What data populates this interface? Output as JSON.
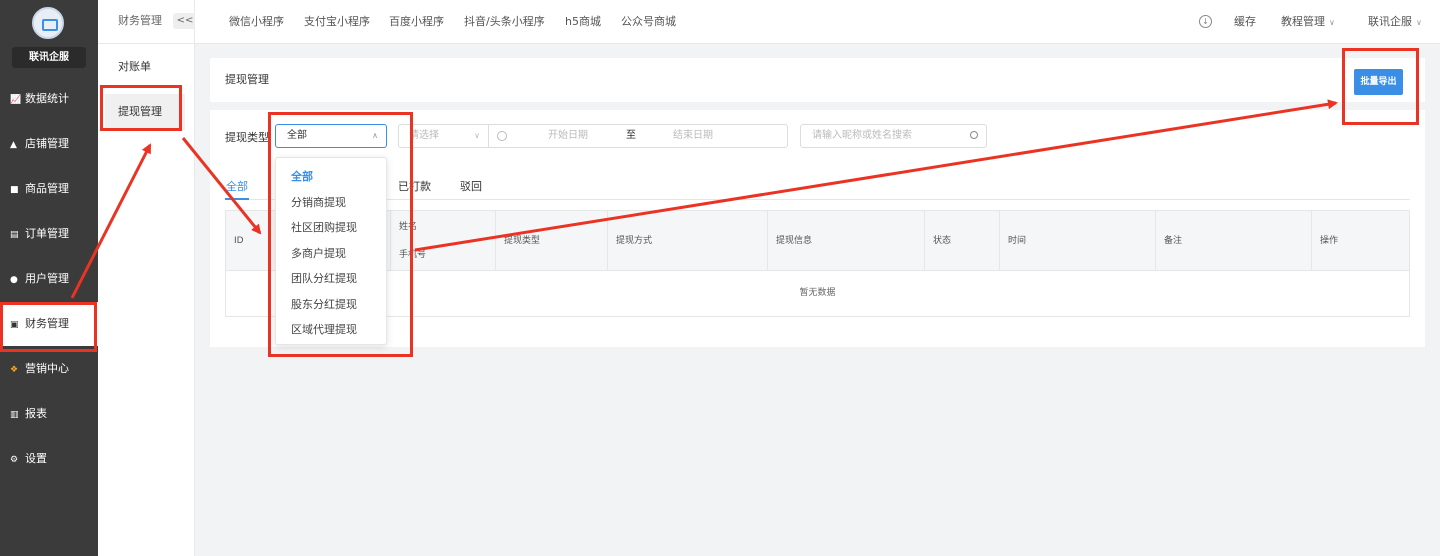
{
  "brand": {
    "name": "联讯企服"
  },
  "sidebar": {
    "items": [
      {
        "label": "数据统计",
        "icon": "chart-line-icon"
      },
      {
        "label": "店铺管理",
        "icon": "store-icon"
      },
      {
        "label": "商品管理",
        "icon": "goods-icon"
      },
      {
        "label": "订单管理",
        "icon": "order-icon"
      },
      {
        "label": "用户管理",
        "icon": "user-icon"
      },
      {
        "label": "财务管理",
        "icon": "finance-icon"
      },
      {
        "label": "营销中心",
        "icon": "marketing-icon"
      },
      {
        "label": "报表",
        "icon": "bar-chart-icon"
      },
      {
        "label": "设置",
        "icon": "gear-icon"
      }
    ]
  },
  "subnav": {
    "title": "财务管理",
    "collapse_label": "<<",
    "items": [
      {
        "label": "对账单"
      },
      {
        "label": "提现管理"
      }
    ]
  },
  "topbar": {
    "tabs": [
      {
        "label": "微信小程序"
      },
      {
        "label": "支付宝小程序"
      },
      {
        "label": "百度小程序"
      },
      {
        "label": "抖音/头条小程序"
      },
      {
        "label": "h5商城"
      },
      {
        "label": "公众号商城"
      }
    ],
    "cache_label": "缓存",
    "tutorial_label": "教程管理",
    "account_label": "联讯企服"
  },
  "page": {
    "title": "提现管理",
    "export_label": "批量导出"
  },
  "filters": {
    "type_label": "提现类型",
    "type_value": "全部",
    "select_placeholder": "请选择",
    "start_placeholder": "开始日期",
    "range_separator": "至",
    "end_placeholder": "结束日期",
    "search_placeholder": "请输入昵称或姓名搜索"
  },
  "status_tabs": [
    {
      "label": "全部"
    },
    {
      "label": "已打款"
    },
    {
      "label": "驳回"
    }
  ],
  "table": {
    "columns": [
      "ID",
      "姓名",
      "手机号",
      "提现类型",
      "提现方式",
      "提现信息",
      "状态",
      "时间",
      "备注",
      "操作"
    ],
    "empty_text": "暂无数据"
  },
  "dropdown": {
    "options": [
      "全部",
      "分销商提现",
      "社区团购提现",
      "多商户提现",
      "团队分红提现",
      "股东分红提现",
      "区域代理提现"
    ],
    "selected": "全部"
  },
  "colors": {
    "sidebar_bg": "#3b3b3b",
    "accent": "#3a8ee6",
    "annotation_red": "#ea3323"
  }
}
